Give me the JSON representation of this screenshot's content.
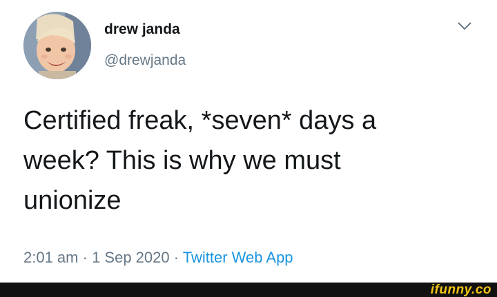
{
  "user": {
    "display_name": "drew janda",
    "handle": "@drewjanda"
  },
  "tweet": {
    "text": "Certified freak, *seven* days a\nweek? This is why we must\nunionize"
  },
  "meta": {
    "time": "2:01 am",
    "separator1": " · ",
    "date": "1 Sep 2020",
    "separator2": " · ",
    "source": "Twitter Web App"
  },
  "watermark": "ifunny.co",
  "colors": {
    "text": "#14171a",
    "secondary": "#657786",
    "link": "#1b95e0",
    "watermark": "#f2c415",
    "footer": "#111111"
  },
  "icons": {
    "menu": "chevron-down-icon",
    "avatar": "avatar"
  }
}
